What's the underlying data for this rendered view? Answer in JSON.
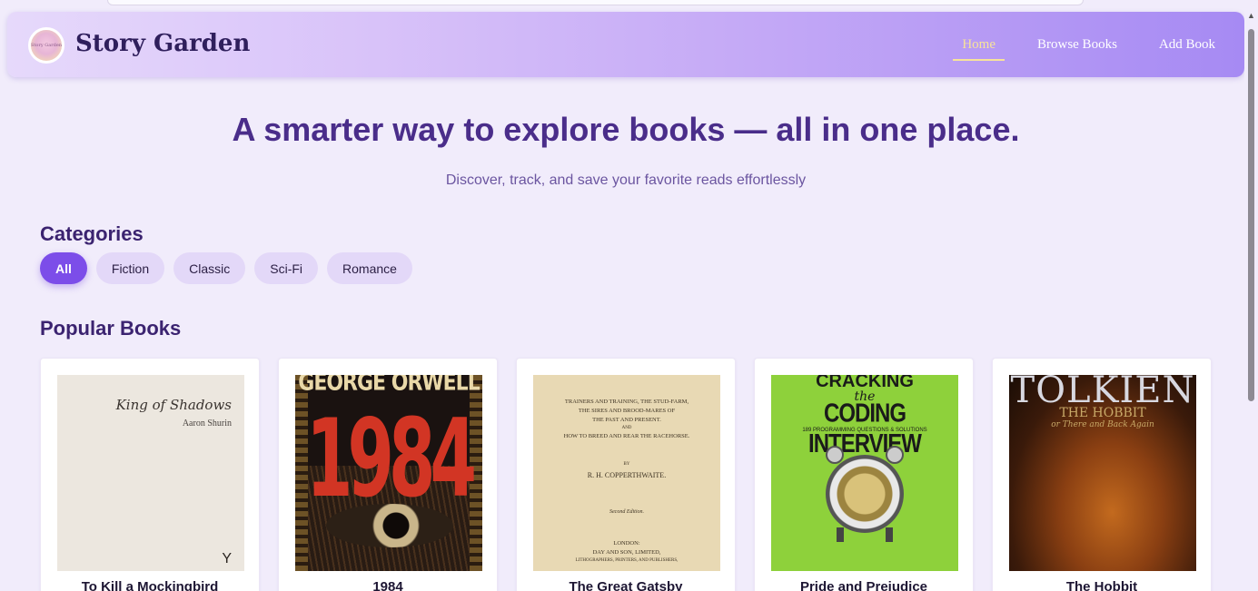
{
  "navbar": {
    "logo_text": "Story Garden",
    "brand": "Story Garden",
    "links": [
      {
        "label": "Home",
        "active": true
      },
      {
        "label": "Browse Books",
        "active": false
      },
      {
        "label": "Add Book",
        "active": false
      }
    ]
  },
  "hero": {
    "title": "A smarter way to explore books — all in one place.",
    "subtitle": "Discover, track, and save your favorite reads effortlessly"
  },
  "categories": {
    "heading": "Categories",
    "items": [
      {
        "label": "All",
        "active": true
      },
      {
        "label": "Fiction",
        "active": false
      },
      {
        "label": "Classic",
        "active": false
      },
      {
        "label": "Sci-Fi",
        "active": false
      },
      {
        "label": "Romance",
        "active": false
      }
    ]
  },
  "popular": {
    "heading": "Popular Books",
    "books": [
      {
        "title": "To Kill a Mockingbird",
        "cover": {
          "title": "King of Shadows",
          "author": "Aaron Shurin",
          "mark": "Y"
        }
      },
      {
        "title": "1984",
        "cover": {
          "author": "GEORGE ORWELL",
          "title": "1984"
        }
      },
      {
        "title": "The Great Gatsby",
        "cover": {
          "lines": [
            "TRAINERS AND TRAINING, THE STUD-FARM,",
            "THE SIRES AND BROOD-MARES OF",
            "THE PAST AND PRESENT.",
            "AND",
            "HOW TO BREED AND REAR THE RACEHORSE.",
            "BY",
            "R. H. COPPERTHWAITE.",
            "Second Edition.",
            "LONDON:",
            "DAY AND SON, LIMITED,",
            "LITHOGRAPHERS, PRINTERS, AND PUBLISHERS,"
          ]
        }
      },
      {
        "title": "Pride and Prejudice",
        "cover": {
          "line1": "CRACKING",
          "line2": "the",
          "line3": "CODING INTERVIEW",
          "line4": "189 PROGRAMMING QUESTIONS & SOLUTIONS"
        }
      },
      {
        "title": "The Hobbit",
        "cover": {
          "author": "TOLKIEN",
          "title": "THE HOBBIT",
          "subtitle": "or There and Back Again"
        }
      }
    ]
  },
  "colors": {
    "accent": "#7c4de9",
    "active_link": "#f7e39a",
    "heading": "#3b2370",
    "background": "#f1ecfb"
  }
}
